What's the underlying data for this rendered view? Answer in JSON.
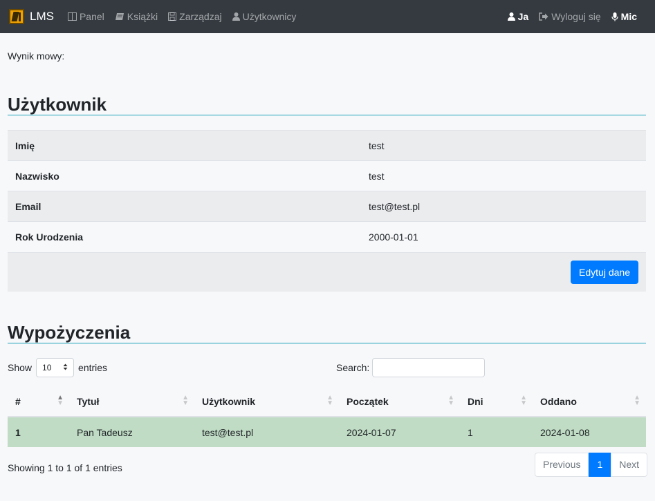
{
  "navbar": {
    "brand": "LMS",
    "links": [
      {
        "label": "Panel",
        "icon": "columns-icon"
      },
      {
        "label": "Książki",
        "icon": "book-icon"
      },
      {
        "label": "Zarządzaj",
        "icon": "save-icon"
      },
      {
        "label": "Użytkownicy",
        "icon": "user-icon"
      }
    ],
    "right": {
      "me": "Ja",
      "logout": "Wyloguj się",
      "mic": "Mic"
    }
  },
  "speech_result": "Wynik mowy:",
  "user_section": {
    "title": "Użytkownik",
    "rows": [
      {
        "key": "Imię",
        "value": "test"
      },
      {
        "key": "Nazwisko",
        "value": "test"
      },
      {
        "key": "Email",
        "value": "test@test.pl"
      },
      {
        "key": "Rok Urodzenia",
        "value": "2000-01-01"
      }
    ],
    "edit_button": "Edytuj dane"
  },
  "loans_section": {
    "title": "Wypożyczenia",
    "show_label": "Show",
    "page_size": "10",
    "entries_label": "entries",
    "search_label": "Search:",
    "columns": [
      "#",
      "Tytuł",
      "Użytkownik",
      "Początek",
      "Dni",
      "Oddano"
    ],
    "rows": [
      {
        "id": "1",
        "title": "Pan Tadeusz",
        "user": "test@test.pl",
        "start": "2024-01-07",
        "days": "1",
        "returned": "2024-01-08"
      }
    ],
    "info": "Showing 1 to 1 of 1 entries",
    "pagination": {
      "previous": "Previous",
      "current": "1",
      "next": "Next"
    }
  },
  "colors": {
    "navbar": "#343a40",
    "primary": "#007bff",
    "section_rule": "#17a2b8",
    "success_row": "#c0dcc4"
  }
}
